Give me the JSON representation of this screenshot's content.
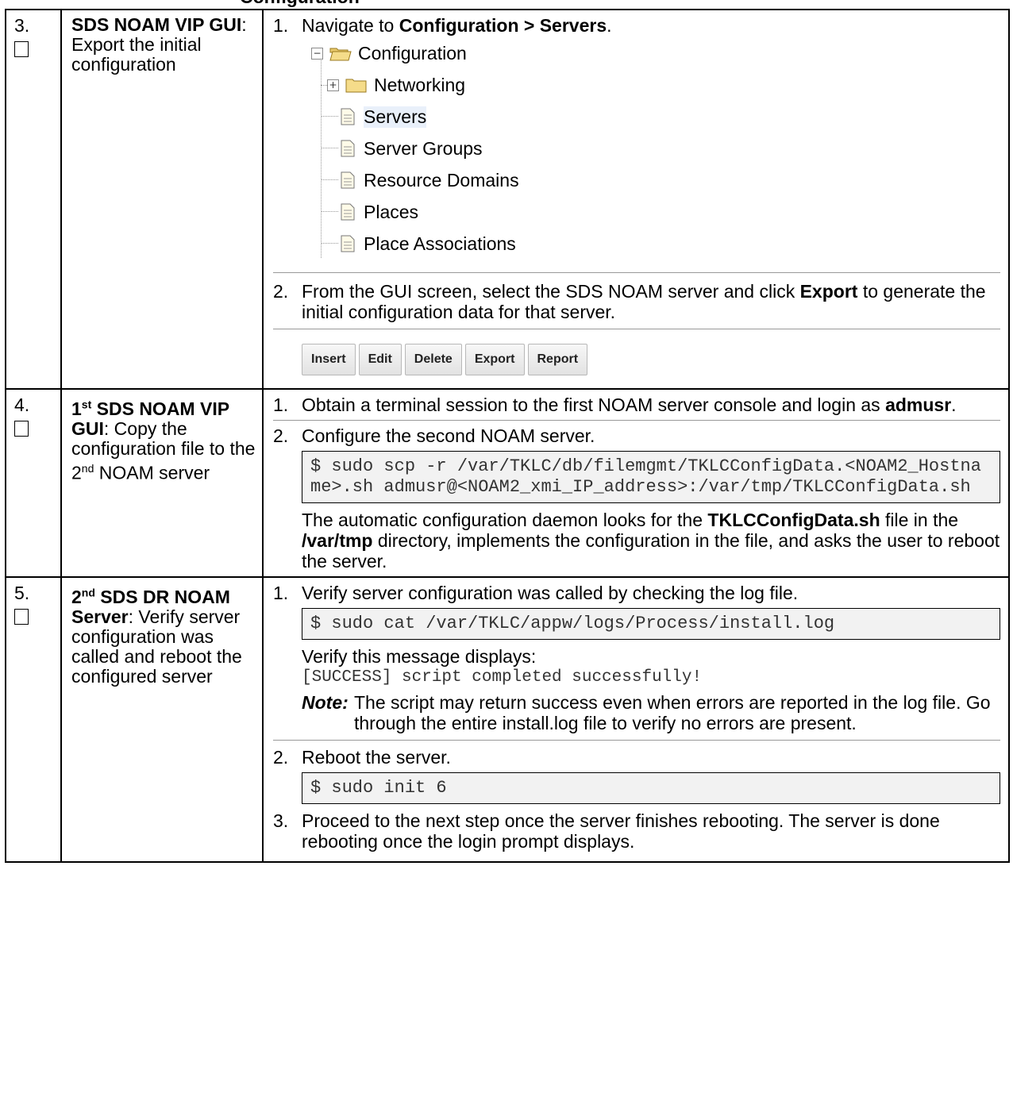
{
  "header_fragment": "Configuration",
  "rows": [
    {
      "num": "3.",
      "title_bold": "SDS NOAM VIP GUI",
      "title_rest": ":  Export the initial configuration",
      "step1_pre": "Navigate to ",
      "step1_bold": "Configuration > Servers",
      "step1_post": ".",
      "tree": {
        "root": "Configuration",
        "folder": "Networking",
        "items": [
          "Servers",
          "Server Groups",
          "Resource Domains",
          "Places",
          "Place Associations"
        ]
      },
      "step2_pre": "From the GUI screen, select the SDS NOAM server and click ",
      "step2_bold": "Export",
      "step2_post": " to generate the initial configuration data for that server.",
      "buttons": [
        "Insert",
        "Edit",
        "Delete",
        "Export",
        "Report"
      ]
    },
    {
      "num": "4.",
      "title_sup_num": "1",
      "title_sup": "st",
      "title_bold": " SDS NOAM VIP GUI",
      "title_rest_a": ":  Copy the configuration file to the 2",
      "title_rest_sup": "nd",
      "title_rest_b": " NOAM server",
      "step1_pre": "Obtain a terminal session to the first NOAM server console and login as ",
      "step1_bold": "admusr",
      "step1_post": ".",
      "step2": "Configure the second NOAM server.",
      "code": "$ sudo scp -r /var/TKLC/db/filemgmt/TKLCConfigData.<NOAM2_Hostname>.sh admusr@<NOAM2_xmi_IP_address>:/var/tmp/TKLCConfigData.sh",
      "para_a": "The automatic configuration daemon looks for the ",
      "para_b": "TKLCConfigData.sh",
      "para_c": " file in the ",
      "para_d": "/var/tmp",
      "para_e": " directory, implements the configuration in the file, and asks the user to reboot the server."
    },
    {
      "num": "5.",
      "title_sup_num": "2",
      "title_sup": "nd",
      "title_bold": " SDS DR NOAM Server",
      "title_rest": ": Verify server configuration was called and reboot the configured server",
      "step1": "Verify server configuration was called by checking the log file.",
      "code1": "$ sudo cat /var/TKLC/appw/logs/Process/install.log",
      "verify": "Verify this message displays:",
      "success": "[SUCCESS] script completed successfully!",
      "note_label": "Note:",
      "note_text": "The script may return success even when errors are reported in the log file.  Go through the entire install.log file to verify no errors are present.",
      "step2": "Reboot the server.",
      "code2": "$ sudo init 6",
      "step3": "Proceed to the next step once the server finishes rebooting.  The server is done rebooting once the login prompt displays."
    }
  ]
}
